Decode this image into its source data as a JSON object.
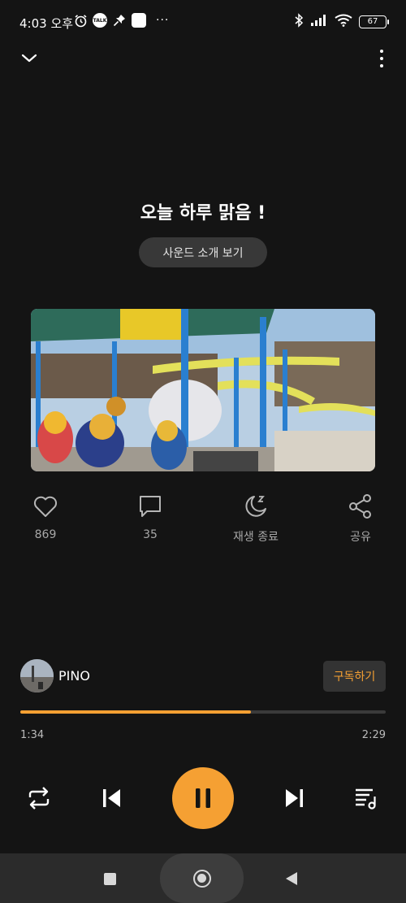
{
  "status_bar": {
    "time": "4:03 오후",
    "notification_icons": [
      "alarm-icon",
      "kakaotalk-icon",
      "pin-icon",
      "app-icon"
    ],
    "kakaotalk_label": "TALK",
    "more": "···",
    "battery": "67"
  },
  "player": {
    "title": "오늘 하루 맑음 !",
    "sound_intro_label": "사운드 소개 보기"
  },
  "actions": {
    "like_count": "869",
    "comment_count": "35",
    "sleep_timer_label": "재생 종료",
    "share_label": "공유"
  },
  "channel": {
    "name": "PINO",
    "subscribe_label": "구독하기"
  },
  "progress": {
    "current_time": "1:34",
    "total_time": "2:29",
    "fraction": 0.63
  },
  "colors": {
    "accent": "#f5a033",
    "background": "#141414"
  }
}
